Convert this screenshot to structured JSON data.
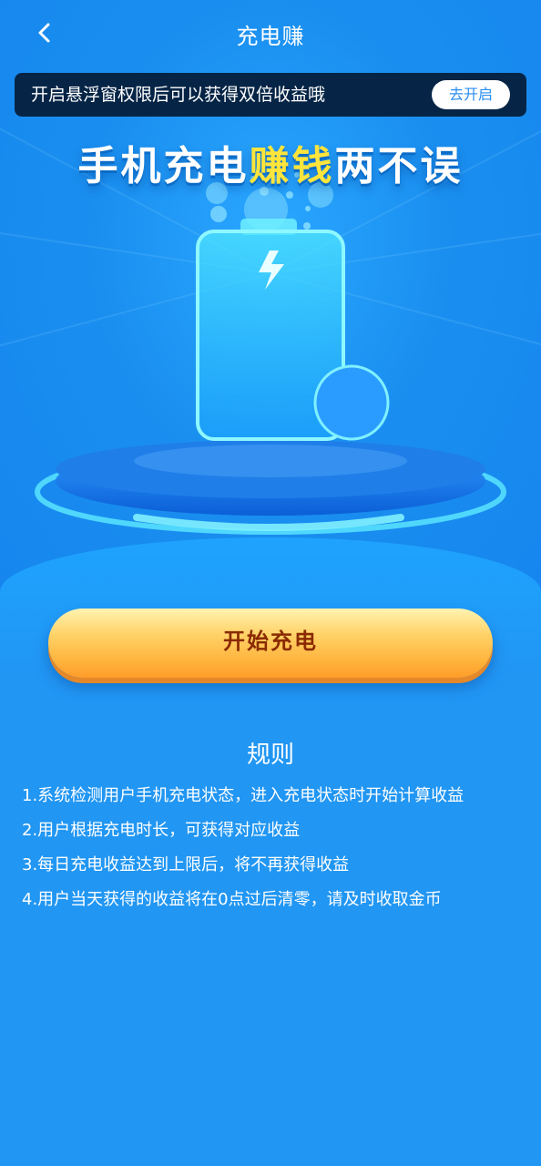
{
  "header": {
    "title": "充电赚"
  },
  "notice": {
    "text": "开启悬浮窗权限后可以获得双倍收益哦",
    "button_label": "去开启"
  },
  "slogan": {
    "part1": "手机充电",
    "highlight": "赚钱",
    "part2": "两不误"
  },
  "start_button": {
    "label": "开始充电"
  },
  "rules": {
    "title": "规则",
    "items": [
      "1.系统检测用户手机充电状态，进入充电状态时开始计算收益",
      "2.用户根据充电时长，可获得对应收益",
      "3.每日充电收益达到上限后，将不再获得收益",
      "4.用户当天获得的收益将在0点过后清零，请及时收取金币"
    ]
  },
  "icons": [
    "back-arrow-icon",
    "lightning-icon",
    "battery-illustration",
    "pedestal-illustration"
  ],
  "colors": {
    "background": "#2196f3",
    "notice_bar": "#062546",
    "slogan_highlight": "#ffe53b",
    "start_button": "#ffb23a",
    "start_button_text": "#8a2a00"
  }
}
